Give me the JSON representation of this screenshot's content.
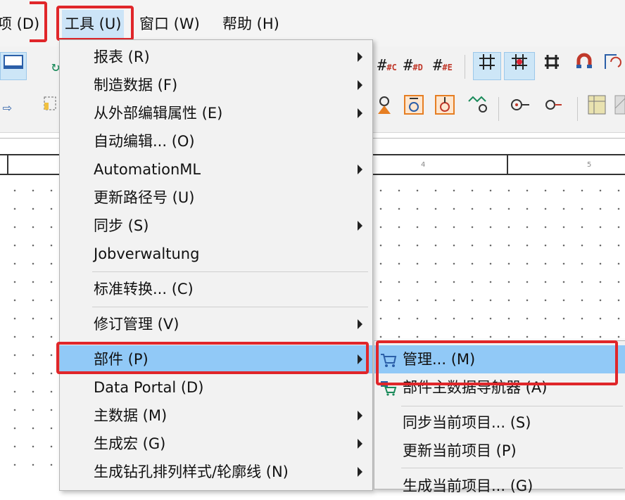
{
  "menubar": {
    "items": [
      {
        "label": "项 (D)"
      },
      {
        "label": "工具 (U)"
      },
      {
        "label": "窗口 (W)"
      },
      {
        "label": "帮助 (H)"
      }
    ]
  },
  "toolbar": {
    "row1_right": [
      "#C",
      "#D",
      "#E"
    ],
    "row1_right_icons": [
      "grid-icon",
      "grid-snap-icon",
      "crop-icon",
      "magnet-icon",
      "rotate-icon"
    ],
    "row2_right_icons": [
      "component-icon",
      "connector-icon",
      "connector-up-icon",
      "wire-icon",
      "node-icon",
      "terminal-icon",
      "table-icon"
    ]
  },
  "ruler": {
    "labels": [
      "4",
      "5"
    ]
  },
  "tools_menu": {
    "items": [
      {
        "label": "报表 (R)",
        "submenu": true
      },
      {
        "label": "制造数据 (F)",
        "submenu": true
      },
      {
        "label": "从外部编辑属性 (E)",
        "submenu": true
      },
      {
        "label": "自动编辑... (O)",
        "submenu": false
      },
      {
        "label": "AutomationML",
        "submenu": true
      },
      {
        "label": "更新路径号 (U)",
        "submenu": false
      },
      {
        "label": "同步 (S)",
        "submenu": true
      },
      {
        "label": "Jobverwaltung",
        "submenu": false
      },
      {
        "label": "标准转换... (C)",
        "submenu": false
      },
      {
        "label": "修订管理 (V)",
        "submenu": true
      },
      {
        "label": "部件 (P)",
        "submenu": true,
        "highlighted": true
      },
      {
        "label": "Data Portal (D)",
        "submenu": false
      },
      {
        "label": "主数据 (M)",
        "submenu": true
      },
      {
        "label": "生成宏 (G)",
        "submenu": true
      },
      {
        "label": "生成钻孔排列样式/轮廓线 (N)",
        "submenu": true
      }
    ]
  },
  "parts_submenu": {
    "items": [
      {
        "label": "管理... (M)",
        "icon": "cart-icon",
        "highlighted": true
      },
      {
        "label": "部件主数据导航器 (A)",
        "icon": "cart-icon"
      },
      {
        "label": "同步当前项目... (S)"
      },
      {
        "label": "更新当前项目 (P)"
      },
      {
        "label": "生成当前项目... (G)"
      }
    ]
  },
  "colors": {
    "highlight": "#91c9f7",
    "annotation_red": "#e0262a"
  }
}
